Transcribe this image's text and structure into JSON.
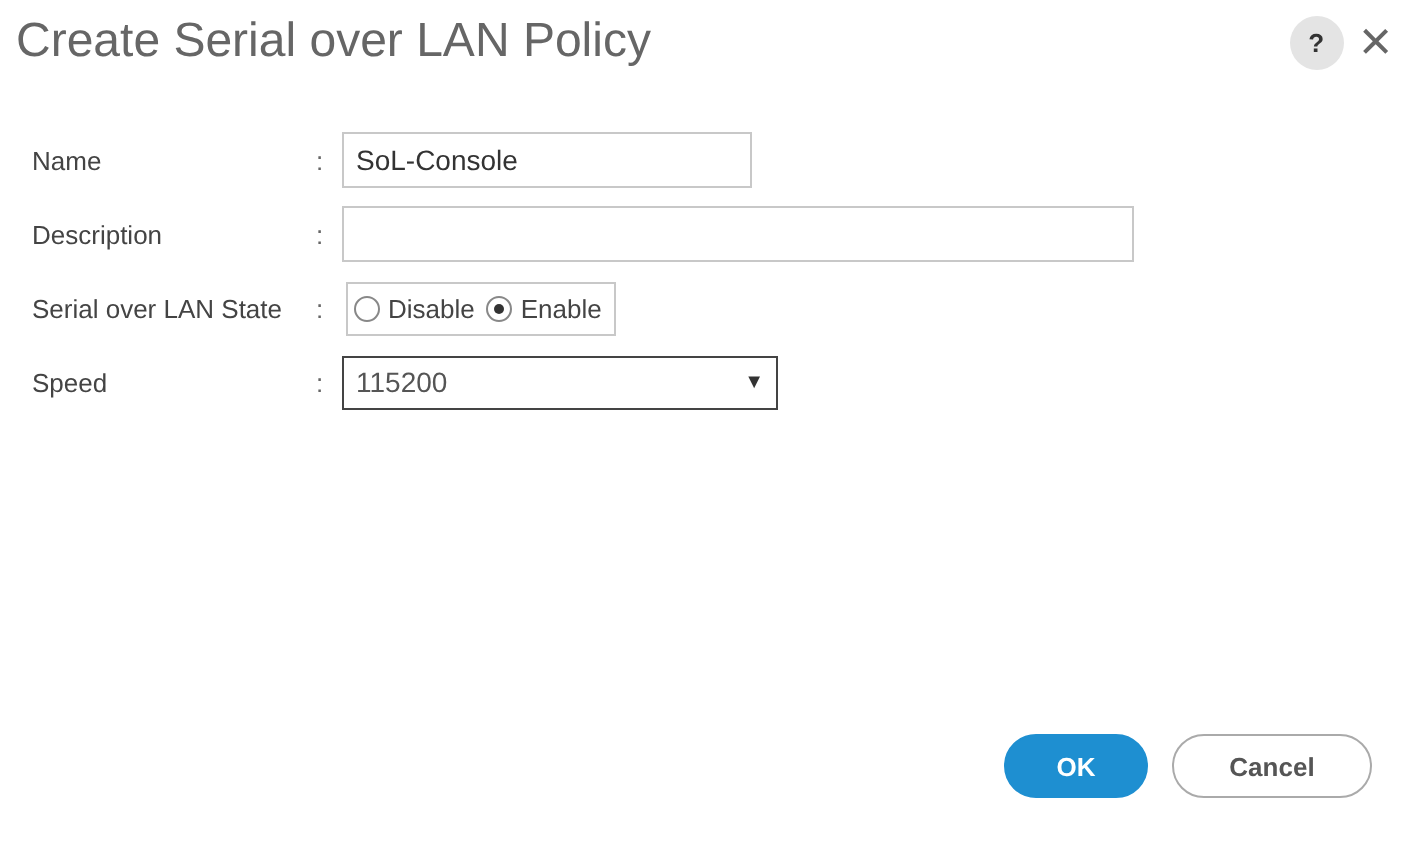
{
  "dialog": {
    "title": "Create Serial over LAN Policy",
    "help_label": "?",
    "close_label": "×"
  },
  "fields": [
    {
      "kind": "text",
      "label": "Name",
      "separator": ":",
      "value": "SoL-Console"
    },
    {
      "kind": "text",
      "label": "Description",
      "separator": ":"
    },
    {
      "kind": "radio",
      "label": "Serial over LAN State",
      "separator": ":",
      "options": [
        {
          "label": "Disable",
          "selected": false
        },
        {
          "label": "Enable",
          "selected": true
        }
      ]
    },
    {
      "kind": "select",
      "label": "Speed",
      "separator": ":",
      "value": "115200",
      "caret": "▼"
    }
  ],
  "buttons": [
    {
      "label": "OK",
      "kind": "primary"
    },
    {
      "label": "Cancel",
      "kind": "secondary"
    }
  ]
}
